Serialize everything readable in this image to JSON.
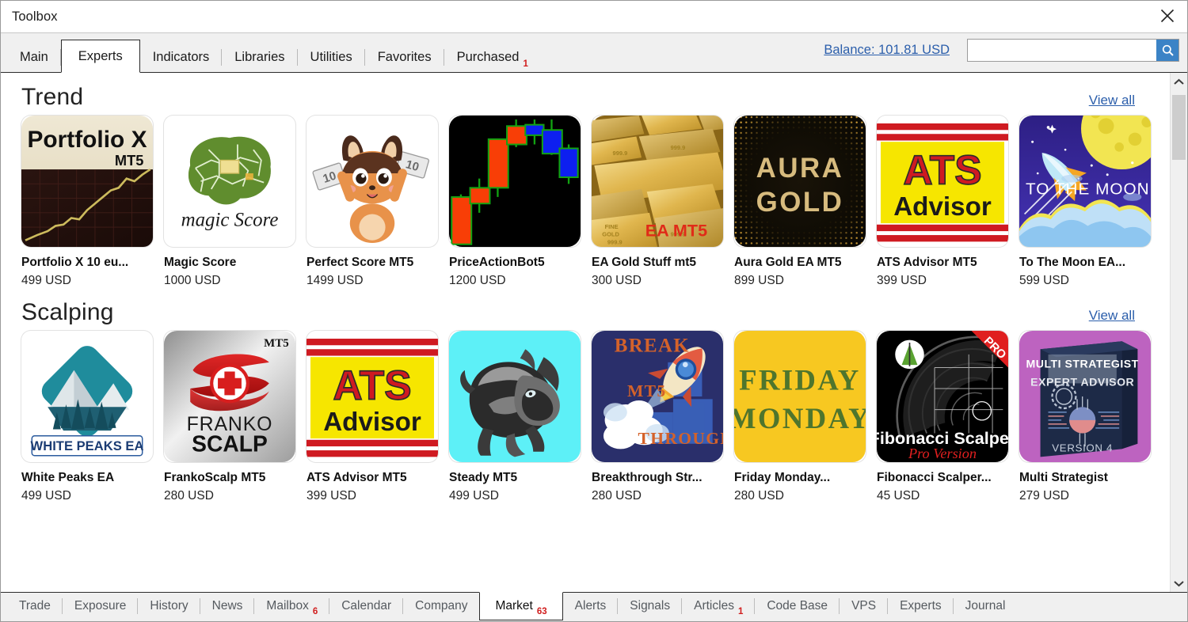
{
  "window": {
    "title": "Toolbox",
    "close_icon": "close-icon"
  },
  "top_tabs": [
    {
      "label": "Main",
      "active": false,
      "badge": ""
    },
    {
      "label": "Experts",
      "active": true,
      "badge": ""
    },
    {
      "label": "Indicators",
      "active": false,
      "badge": ""
    },
    {
      "label": "Libraries",
      "active": false,
      "badge": ""
    },
    {
      "label": "Utilities",
      "active": false,
      "badge": ""
    },
    {
      "label": "Favorites",
      "active": false,
      "badge": ""
    },
    {
      "label": "Purchased",
      "active": false,
      "badge": "1"
    }
  ],
  "balance": {
    "label": "Balance: 101.81 USD"
  },
  "search": {
    "value": "",
    "placeholder": "",
    "icon": "search-icon"
  },
  "sections": [
    {
      "title": "Trend",
      "view_all": "View all",
      "items": [
        {
          "name": "Portfolio X 10 eu...",
          "price": "499 USD",
          "art": "portfoliox"
        },
        {
          "name": "Magic Score",
          "price": "1000 USD",
          "art": "magicscore"
        },
        {
          "name": "Perfect Score MT5",
          "price": "1499 USD",
          "art": "perfectscore"
        },
        {
          "name": "PriceActionBot5",
          "price": "1200 USD",
          "art": "priceaction"
        },
        {
          "name": "EA Gold Stuff mt5",
          "price": "300 USD",
          "art": "goldstuff"
        },
        {
          "name": "Aura Gold EA MT5",
          "price": "899 USD",
          "art": "auragold"
        },
        {
          "name": "ATS Advisor MT5",
          "price": "399 USD",
          "art": "ats"
        },
        {
          "name": "To The Moon EA...",
          "price": "599 USD",
          "art": "tothemoon"
        }
      ]
    },
    {
      "title": "Scalping",
      "view_all": "View all",
      "items": [
        {
          "name": "White Peaks EA",
          "price": "499 USD",
          "art": "whitepeaks"
        },
        {
          "name": "FrankoScalp MT5",
          "price": "280 USD",
          "art": "franko"
        },
        {
          "name": "ATS Advisor MT5",
          "price": "399 USD",
          "art": "ats"
        },
        {
          "name": "Steady MT5",
          "price": "499 USD",
          "art": "steady"
        },
        {
          "name": "Breakthrough Str...",
          "price": "280 USD",
          "art": "breakthrough"
        },
        {
          "name": "Friday Monday...",
          "price": "280 USD",
          "art": "fridaymonday"
        },
        {
          "name": "Fibonacci Scalper...",
          "price": "45 USD",
          "art": "fibonacci"
        },
        {
          "name": "Multi Strategist",
          "price": "279 USD",
          "art": "multistrategist"
        }
      ]
    }
  ],
  "thumb_text": {
    "portfoliox_title": "Portfolio X",
    "portfoliox_sub": "MT5",
    "magicscore_title": "magic Score",
    "goldstuff_tag": "EA MT5",
    "auragold_line1": "AURA",
    "auragold_line2": "GOLD",
    "ats_line1": "ATS",
    "ats_line2": "Advisor",
    "tothemoon_label": "TO THE MOON",
    "whitepeaks_label": "WHITE PEAKS EA",
    "franko_line1": "FRANKO",
    "franko_line2": "SCALP",
    "franko_tag": "MT5",
    "breakthrough_1": "BREAK",
    "breakthrough_2": "MT5",
    "breakthrough_3": "THROUGH",
    "friday_line1": "FRIDAY",
    "friday_line2": "MONDAY",
    "fib_title": "Fibonacci Scalper",
    "fib_sub": "Pro Version",
    "fib_tag": "PRO",
    "multi_line1": "MULTI STRATEGIST",
    "multi_line2": "EXPERT ADVISOR",
    "multi_line3": "VERSION 4"
  },
  "scrollbar": {
    "up_icon": "chevron-up-icon",
    "down_icon": "chevron-down-icon"
  },
  "bottom_tabs": [
    {
      "label": "Trade",
      "active": false,
      "badge": ""
    },
    {
      "label": "Exposure",
      "active": false,
      "badge": ""
    },
    {
      "label": "History",
      "active": false,
      "badge": ""
    },
    {
      "label": "News",
      "active": false,
      "badge": ""
    },
    {
      "label": "Mailbox",
      "active": false,
      "badge": "6"
    },
    {
      "label": "Calendar",
      "active": false,
      "badge": ""
    },
    {
      "label": "Company",
      "active": false,
      "badge": ""
    },
    {
      "label": "Market",
      "active": true,
      "badge": "63"
    },
    {
      "label": "Alerts",
      "active": false,
      "badge": ""
    },
    {
      "label": "Signals",
      "active": false,
      "badge": ""
    },
    {
      "label": "Articles",
      "active": false,
      "badge": "1"
    },
    {
      "label": "Code Base",
      "active": false,
      "badge": ""
    },
    {
      "label": "VPS",
      "active": false,
      "badge": ""
    },
    {
      "label": "Experts",
      "active": false,
      "badge": ""
    },
    {
      "label": "Journal",
      "active": false,
      "badge": ""
    }
  ],
  "colors": {
    "link": "#2b5eab",
    "badge": "#d01c1c",
    "chrome": "#f0f0f0",
    "accent_search": "#3b83c6"
  }
}
